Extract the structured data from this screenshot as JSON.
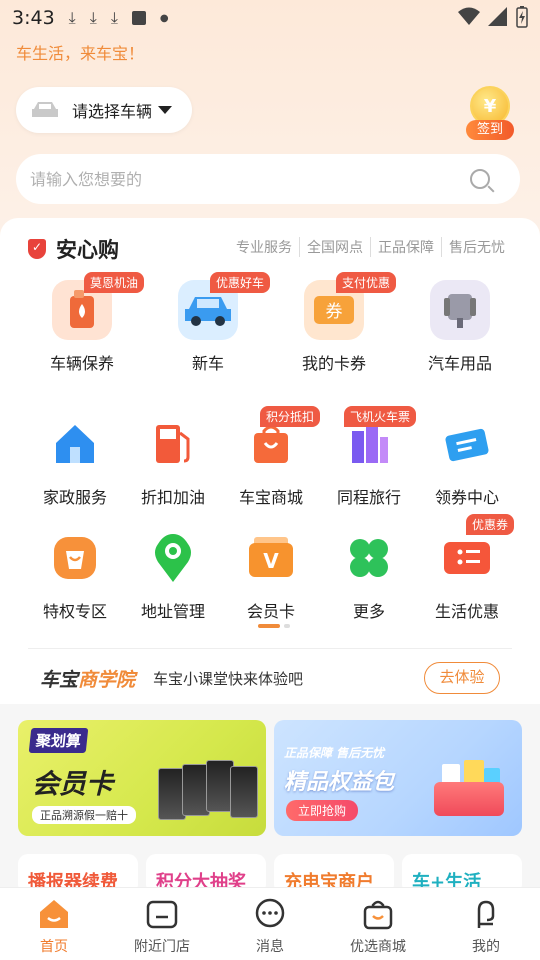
{
  "status_bar": {
    "time": "3:43"
  },
  "slogan": "车生活，来车宝！",
  "vehicle_select": {
    "label": "请选择车辆"
  },
  "checkin": {
    "label": "签到"
  },
  "search": {
    "placeholder": "请输入您想要的"
  },
  "anxin": {
    "title": "安心购",
    "guarantees": [
      "专业服务",
      "全国网点",
      "正品保障",
      "售后无忧"
    ]
  },
  "row1": [
    {
      "label": "车辆保养",
      "badge": "莫恩机油"
    },
    {
      "label": "新车",
      "badge": "优惠好车"
    },
    {
      "label": "我的卡券",
      "badge": "支付优惠"
    },
    {
      "label": "汽车用品",
      "badge": ""
    }
  ],
  "row2": [
    {
      "label": "家政服务",
      "badge": ""
    },
    {
      "label": "折扣加油",
      "badge": ""
    },
    {
      "label": "车宝商城",
      "badge": "积分抵扣"
    },
    {
      "label": "同程旅行",
      "badge": "飞机火车票"
    },
    {
      "label": "领券中心",
      "badge": ""
    }
  ],
  "row3": [
    {
      "label": "特权专区",
      "badge": ""
    },
    {
      "label": "地址管理",
      "badge": ""
    },
    {
      "label": "会员卡",
      "badge": ""
    },
    {
      "label": "更多",
      "badge": ""
    },
    {
      "label": "生活优惠",
      "badge": "优惠券"
    }
  ],
  "academy": {
    "brand_a": "车宝",
    "brand_b": "商学院",
    "desc": "车宝小课堂快来体验吧",
    "button": "去体验"
  },
  "banner_left": {
    "tag": "聚划算",
    "title": "会员卡",
    "note": "正品溯源假一赔十"
  },
  "banner_right": {
    "tag": "正品保障 售后无忧",
    "title": "精品权益包",
    "button": "立即抢购"
  },
  "chips": [
    "播报器续费",
    "积分大抽奖",
    "充电宝商户",
    "车+生活"
  ],
  "tabs": [
    {
      "label": "首页",
      "icon": "home-icon",
      "active": true
    },
    {
      "label": "附近门店",
      "icon": "store-icon",
      "active": false
    },
    {
      "label": "消息",
      "icon": "message-icon",
      "active": false
    },
    {
      "label": "优选商城",
      "icon": "shopping-bag-icon",
      "active": false
    },
    {
      "label": "我的",
      "icon": "profile-icon",
      "active": false
    }
  ],
  "colors": {
    "accent": "#f08b3a",
    "badge": "#ef5a43",
    "active_tab": "#f07c2e"
  }
}
